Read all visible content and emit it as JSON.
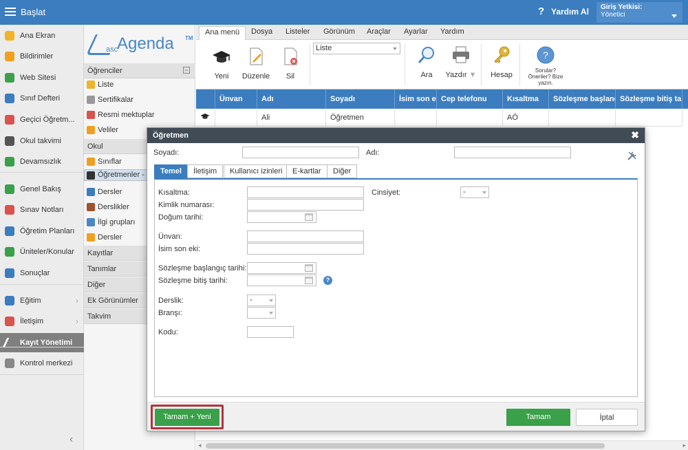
{
  "topbar": {
    "brand": "Başlat",
    "help": "Yardım Al",
    "role_label": "Giriş Yetkisi:",
    "role_value": "Yönetici"
  },
  "leftnav": {
    "items": [
      {
        "label": "Ana Ekran",
        "color": "#f0b429"
      },
      {
        "label": "Bildirimler",
        "color": "#f0a020"
      },
      {
        "label": "Web Sitesi",
        "color": "#3aa04a"
      },
      {
        "label": "Sınıf Defteri",
        "color": "#3b7dbf"
      },
      {
        "label": "Geçici Öğretm...",
        "color": "#d9534f"
      },
      {
        "label": "Okul takvimi",
        "color": "#555555"
      },
      {
        "label": "Devamsızlık",
        "color": "#3aa04a"
      },
      {
        "label": "Genel Bakış",
        "color": "#3aa04a"
      },
      {
        "label": "Sınav Notları",
        "color": "#d9534f"
      },
      {
        "label": "Öğretim Planları",
        "color": "#3b7dbf"
      },
      {
        "label": "Üniteler/Konular",
        "color": "#3aa04a"
      },
      {
        "label": "Sonuçlar",
        "color": "#3b7dbf"
      },
      {
        "label": "Eğitim",
        "color": "#3b7dbf"
      },
      {
        "label": "İletişim",
        "color": "#d9534f"
      },
      {
        "label": "Kayıt Yönetimi",
        "color": "#ffffff"
      },
      {
        "label": "Kontrol merkezi",
        "color": "#888888"
      }
    ]
  },
  "tree": {
    "logo_small": "asc",
    "logo_big": "Agenda",
    "logo_tm": "TM",
    "section_students": "Öğrenciler",
    "students_items": [
      "Liste",
      "Sertifikalar",
      "Resmi mektuplar",
      "Veliler"
    ],
    "section_school": "Okul",
    "school_items": [
      "Sınıflar",
      "Öğretmenler - F",
      "Dersler",
      "Derslikler",
      "İlgi grupları",
      "Dersler"
    ],
    "sections_other": [
      "Kayıtlar",
      "Tanımlar",
      "Diğer",
      "Ek Görünümler",
      "Takvim"
    ]
  },
  "ribbon": {
    "tabs": [
      "Ana menü",
      "Dosya",
      "Listeler",
      "Görünüm",
      "Araçlar",
      "Ayarlar",
      "Yardım"
    ],
    "btn_new": "Yeni",
    "btn_edit": "Düzenle",
    "btn_delete": "Sil",
    "view_select": "Liste",
    "btn_search": "Ara",
    "btn_print": "Yazdır",
    "btn_account": "Hesap",
    "btn_questions": "Sorular? Öneriler? Bize yazın."
  },
  "grid": {
    "columns": [
      "Ünvan",
      "Adı",
      "Soyadı",
      "İsim son eki",
      "Cep telefonu",
      "Kısaltma",
      "Sözleşme başlangıç",
      "Sözleşme bitiş tarihi"
    ],
    "row": {
      "adi": "Ali",
      "soyadi": "Öğretmen",
      "kisaltma": "AÖ"
    }
  },
  "dialog": {
    "title": "Öğretmen",
    "soyadi_label": "Soyadı:",
    "adi_label": "Adı:",
    "tabs": [
      "Temel",
      "İletişim",
      "Kullanıcı izinleri",
      "E-kartlar",
      "Diğer"
    ],
    "fields": {
      "kisaltma": "Kısaltma:",
      "kimlik": "Kimlik numarası:",
      "dogum": "Doğum tarihi:",
      "unvan": "Ünvan:",
      "isim_son_eki": "İsim son eki:",
      "sozlesme_bas": "Sözleşme başlangıç tarihi:",
      "sozlesme_bit": "Sözleşme bitiş tarihi:",
      "derslik": "Derslik:",
      "bransi": "Branşı:",
      "kodu": "Kodu:",
      "cinsiyet": "Cinsiyet:"
    },
    "cinsiyet_value": "-",
    "derslik_value": "-",
    "bransi_value": "",
    "btn_ok_new": "Tamam + Yeni",
    "btn_ok": "Tamam",
    "btn_cancel": "İptal"
  }
}
